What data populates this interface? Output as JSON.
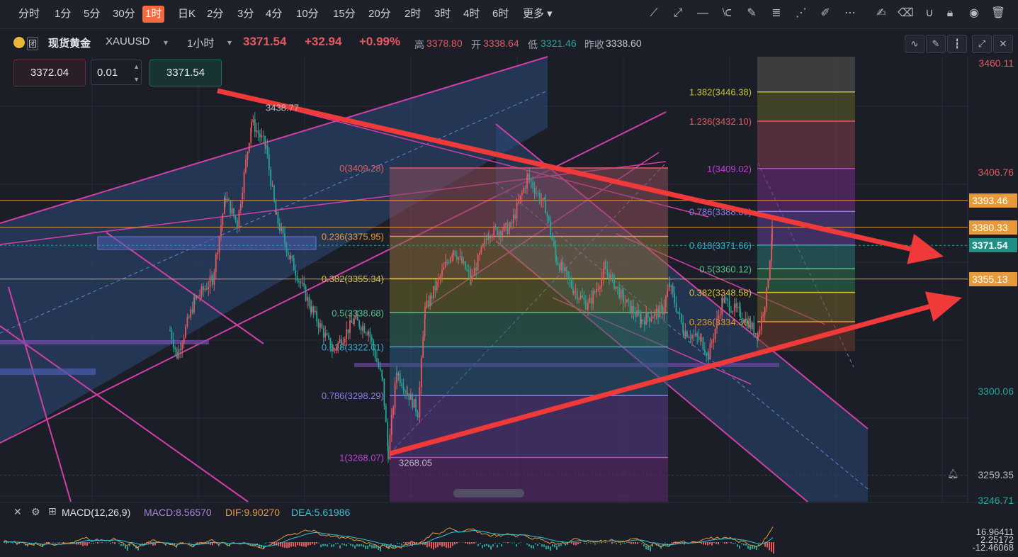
{
  "toolbar": {
    "timeframes": [
      "分时",
      "1分",
      "5分",
      "30分",
      "1时",
      "日K",
      "2分",
      "3分",
      "4分",
      "10分",
      "15分",
      "20分",
      "2时",
      "3时",
      "4时",
      "6时"
    ],
    "active_timeframe": "1时",
    "more_label": "更多"
  },
  "symbol": {
    "name": "现货黄金",
    "code": "XAUUSD",
    "badge": "团",
    "interval": "1小时",
    "last": "3371.54",
    "change": "+32.94",
    "change_pct": "+0.99%",
    "high_label": "高",
    "high": "3378.80",
    "open_label": "开",
    "open": "3338.64",
    "low_label": "低",
    "low": "3321.46",
    "prev_close_label": "昨收",
    "prev_close": "3338.60"
  },
  "order": {
    "sell_price": "3372.04",
    "lot": "0.01",
    "buy_price": "3371.54"
  },
  "colors": {
    "up": "#e7585f",
    "down": "#26a69a",
    "background": "#1b1e27",
    "orange_level": "#e79a3a",
    "arrow": "#f03a3a"
  },
  "chart_data": {
    "type": "candlestick",
    "ylim": [
      3240,
      3465
    ],
    "y_ticks": [
      "3460.11",
      "3406.76",
      "3300.06",
      "3259.35",
      "3246.71"
    ],
    "price_tags": [
      {
        "label": "3393.46",
        "value": 3393.46,
        "color": "#e79a3a"
      },
      {
        "label": "3380.33",
        "value": 3380.33,
        "color": "#e79a3a"
      },
      {
        "label": "3371.54",
        "value": 3371.54,
        "color": "#1f8f85"
      },
      {
        "label": "3355.13",
        "value": 3355.13,
        "color": "#e79a3a"
      }
    ],
    "annotations": [
      {
        "text": "3438.77",
        "value": 3438.77
      },
      {
        "text": "3268.05",
        "value": 3268.05
      }
    ],
    "fib_left": {
      "levels": [
        {
          "label": "0(3409.28)",
          "value": 3409.28,
          "color": "#e7585f"
        },
        {
          "label": "0.236(3375.95)",
          "value": 3375.95,
          "color": "#e79a3a"
        },
        {
          "label": "0.382(3355.34)",
          "value": 3355.34,
          "color": "#d6c43a"
        },
        {
          "label": "0.5(3338.68)",
          "value": 3338.68,
          "color": "#4fc38a"
        },
        {
          "label": "0.618(3322.01)",
          "value": 3322.01,
          "color": "#3aa9c9"
        },
        {
          "label": "0.786(3298.29)",
          "value": 3298.29,
          "color": "#8f7be0"
        },
        {
          "label": "1(3268.07)",
          "value": 3268.07,
          "color": "#c23fd6"
        }
      ]
    },
    "fib_right": {
      "levels": [
        {
          "label": "1.382(3446.38)",
          "value": 3446.38,
          "color": "#c7c23a"
        },
        {
          "label": "1.236(3432.10)",
          "value": 3432.1,
          "color": "#e7585f"
        },
        {
          "label": "1(3409.02)",
          "value": 3409.02,
          "color": "#c23fd6"
        },
        {
          "label": "0.786(3388.09)",
          "value": 3388.09,
          "color": "#8f7be0"
        },
        {
          "label": "0.618(3371.66)",
          "value": 3371.66,
          "color": "#3aa9c9"
        },
        {
          "label": "0.5(3360.12)",
          "value": 3360.12,
          "color": "#4fc38a"
        },
        {
          "label": "0.382(3348.58)",
          "value": 3348.58,
          "color": "#d6c43a"
        },
        {
          "label": "0.236(3334.30)",
          "value": 3334.3,
          "color": "#e79a3a"
        }
      ]
    },
    "macd": {
      "name": "MACD(12,26,9)",
      "macd": "MACD:8.56570",
      "dif": "DIF:9.90270",
      "dea": "DEA:5.61986",
      "axis": [
        "16.96411",
        "2.25172",
        "-12.46068"
      ]
    }
  }
}
